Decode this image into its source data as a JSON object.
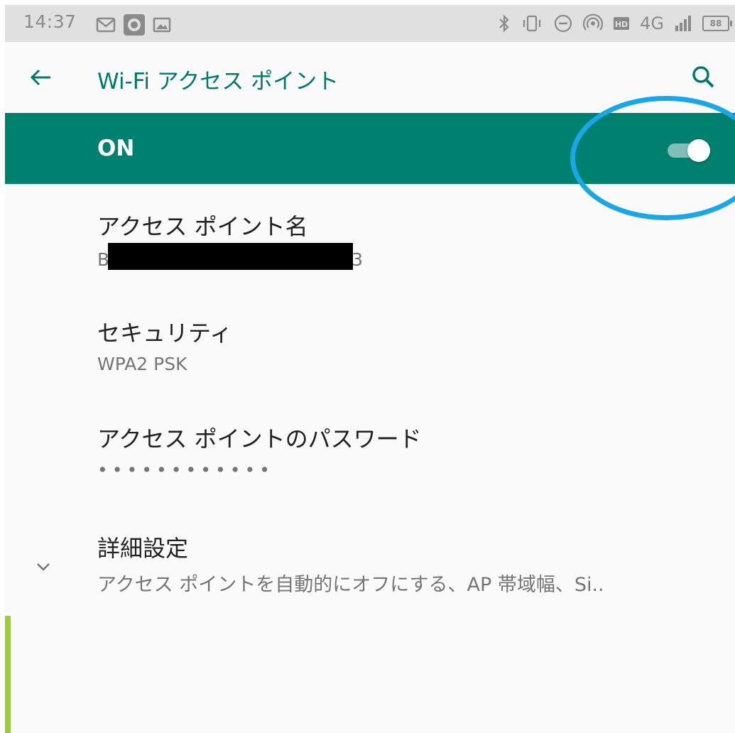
{
  "status_bar": {
    "time": "14:37",
    "battery": "88",
    "network": "4G",
    "left_icons": [
      "gmail-icon",
      "record-icon",
      "image-icon"
    ],
    "right_icons": [
      "bluetooth-icon",
      "vibrate-icon",
      "dnd-icon",
      "hotspot-icon",
      "hd-icon",
      "signal-icon",
      "battery-icon"
    ]
  },
  "app_bar": {
    "title": "Wi-Fi アクセス ポイント",
    "back_icon": "arrow-back-icon",
    "search_icon": "search-icon"
  },
  "switch_bar": {
    "label": "ON",
    "state": true,
    "accent_color": "#00806f"
  },
  "settings": {
    "ap_name": {
      "title": "アクセス ポイント名",
      "value_start": "B",
      "value_end": "3"
    },
    "security": {
      "title": "セキュリティ",
      "value": "WPA2 PSK"
    },
    "password": {
      "title": "アクセス ポイントのパスワード",
      "value": "••••••••••••"
    },
    "advanced": {
      "title": "詳細設定",
      "summary": "アクセス ポイントを自動的にオフにする、AP 帯域幅、Si.."
    }
  },
  "annotation_color": "#1aa7e6"
}
